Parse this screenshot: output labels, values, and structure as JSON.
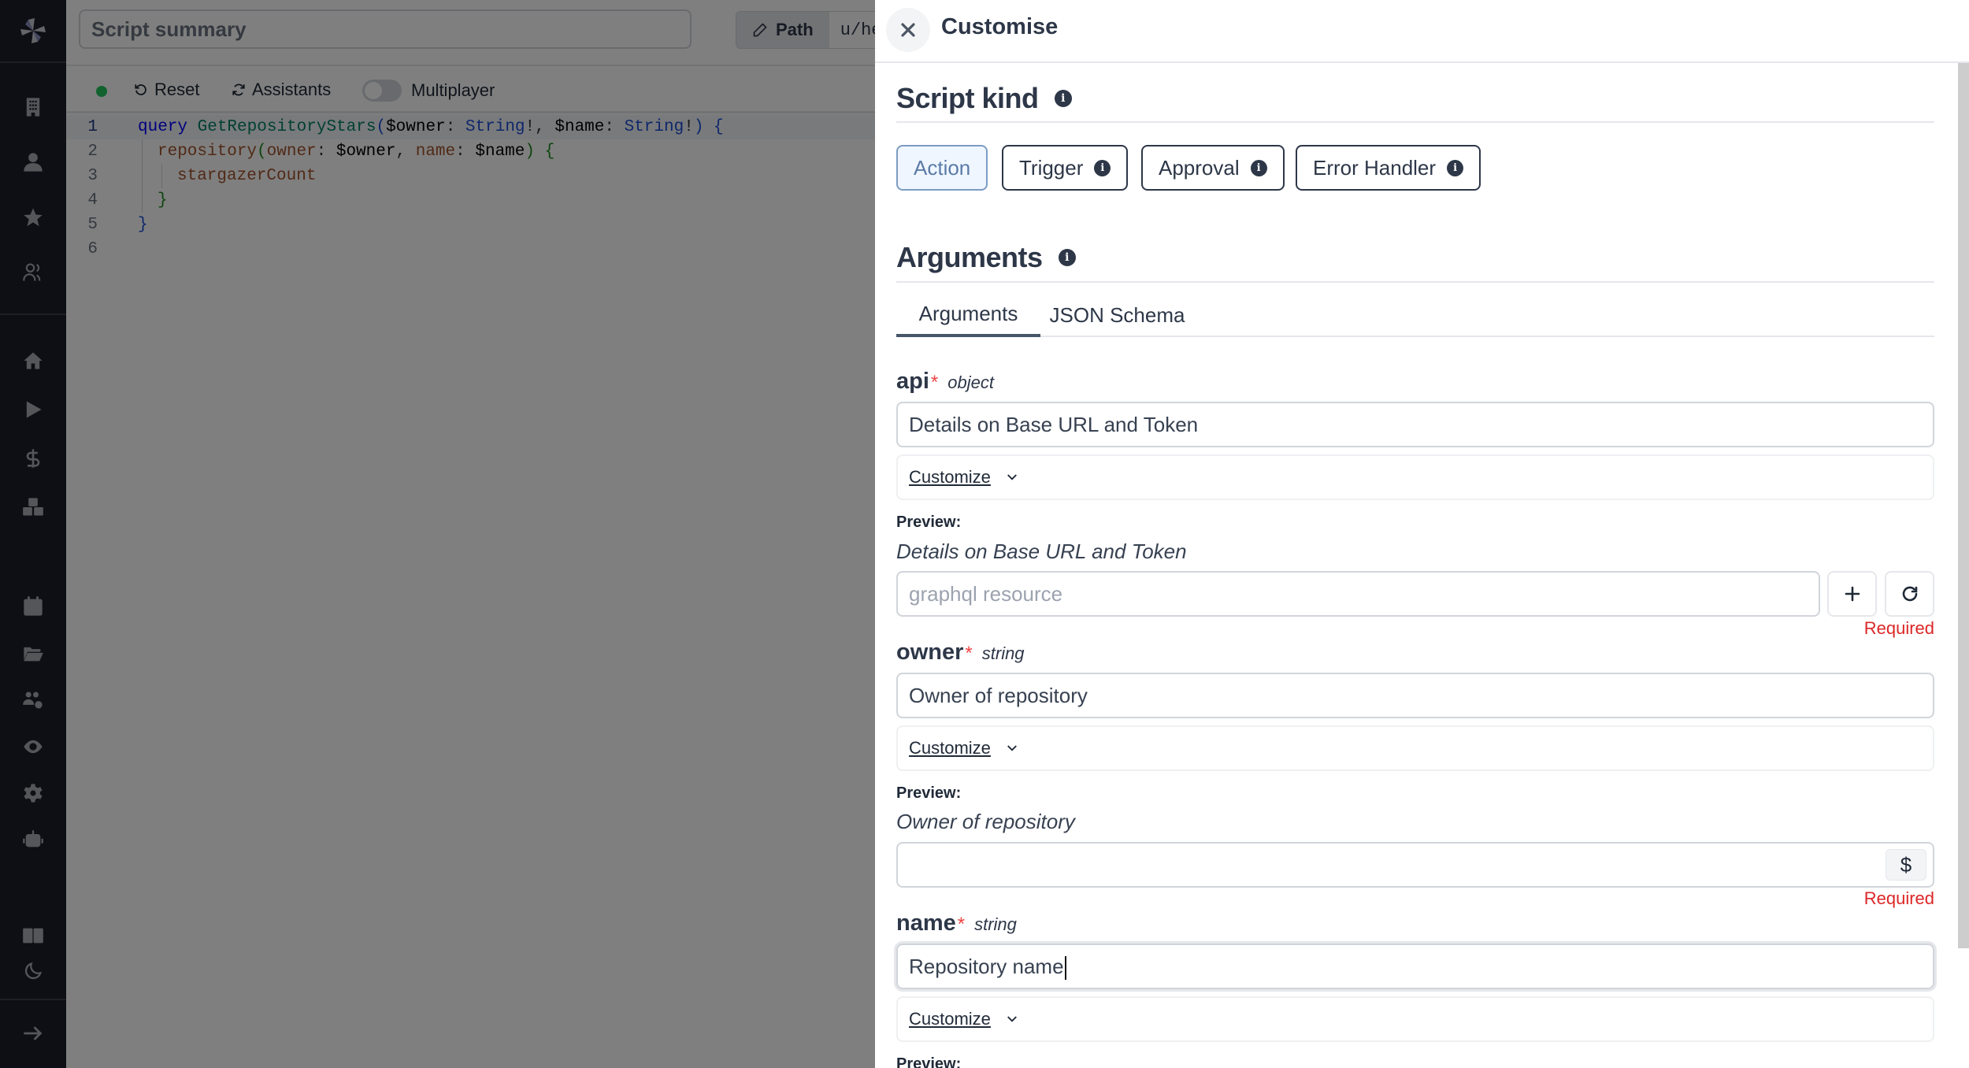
{
  "sidebar": {
    "logo": "windmill-logo",
    "top_icons": [
      "building-icon",
      "user-icon",
      "star-icon",
      "users-icon"
    ],
    "main_icons": [
      "home-icon",
      "play-icon",
      "dollar-icon",
      "boxes-icon"
    ],
    "lower_icons": [
      "calendar-icon",
      "folder-open-icon",
      "users-cog-icon",
      "eye-icon",
      "gear-icon",
      "robot-icon"
    ],
    "bottom_icons": [
      "book-open-icon",
      "moon-icon"
    ],
    "expand_icon": "arrow-right-icon"
  },
  "topbar": {
    "summary_placeholder": "Script summary",
    "path_label": "Path",
    "path_value": "u/he"
  },
  "toolbar": {
    "status": "connected",
    "reset_label": "Reset",
    "assistants_label": "Assistants",
    "multiplayer_label": "Multiplayer",
    "multiplayer_on": false
  },
  "editor": {
    "lines": [
      {
        "n": "1"
      },
      {
        "n": "2"
      },
      {
        "n": "3"
      },
      {
        "n": "4"
      },
      {
        "n": "5"
      },
      {
        "n": "6"
      }
    ],
    "tokens": {
      "l1_kw": "query",
      "l1_name": "GetRepositoryStars",
      "l1_open": "(",
      "l1_v1": "$owner",
      "l1_c1": ": ",
      "l1_t1": "String",
      "l1_b1": "!, ",
      "l1_v2": "$name",
      "l1_c2": ": ",
      "l1_t2": "String",
      "l1_b2": "!",
      "l1_close": ")",
      "l1_brace": " {",
      "l2_field": "repository",
      "l2_open": "(",
      "l2_arg1": "owner",
      "l2_c1": ": ",
      "l2_v1": "$owner",
      "l2_comma": ", ",
      "l2_arg2": "name",
      "l2_c2": ": ",
      "l2_v2": "$name",
      "l2_close": ")",
      "l2_brace": " {",
      "l3_field": "stargazerCount",
      "l4_brace": "}",
      "l5_brace": "}"
    }
  },
  "drawer": {
    "title": "Customise",
    "script_kind": {
      "heading": "Script kind",
      "options": [
        {
          "label": "Action",
          "selected": true,
          "info": false
        },
        {
          "label": "Trigger",
          "selected": false,
          "info": true
        },
        {
          "label": "Approval",
          "selected": false,
          "info": true
        },
        {
          "label": "Error Handler",
          "selected": false,
          "info": true
        }
      ]
    },
    "arguments": {
      "heading": "Arguments",
      "tabs": [
        {
          "label": "Arguments",
          "active": true
        },
        {
          "label": "JSON Schema",
          "active": false
        }
      ],
      "fields": [
        {
          "name": "api",
          "required": true,
          "type": "object",
          "description": "Details on Base URL and Token",
          "customize_label": "Customize",
          "preview_label": "Preview:",
          "preview_text": "Details on Base URL and Token",
          "resource_placeholder": "graphql resource",
          "validation": "Required"
        },
        {
          "name": "owner",
          "required": true,
          "type": "string",
          "description": "Owner of repository",
          "customize_label": "Customize",
          "preview_label": "Preview:",
          "preview_text": "Owner of repository",
          "value": "",
          "dollar_label": "$",
          "validation": "Required"
        },
        {
          "name": "name",
          "required": true,
          "type": "string",
          "description": "Repository name",
          "customize_label": "Customize",
          "preview_label": "Preview:"
        }
      ]
    }
  },
  "colors": {
    "sidebar_bg": "#1a1f2b",
    "text_primary": "#2d3748",
    "required_red": "#dc2626",
    "selected_kind_bg": "#eff6ff",
    "selected_kind_text": "#5b7ba6",
    "status_green": "#22c55e"
  }
}
